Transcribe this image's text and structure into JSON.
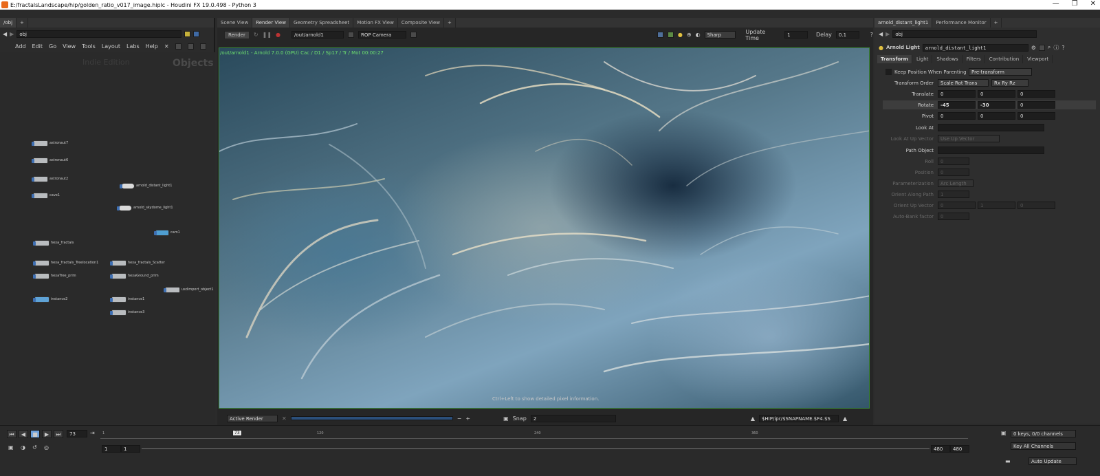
{
  "window": {
    "title": "E:/fractalsLandscape/hip/golden_ratio_v017_image.hiplc - Houdini FX 19.0.498 - Python 3",
    "controls": [
      "—",
      "❐",
      "✕"
    ]
  },
  "left": {
    "tab": "/obj",
    "path": "obj",
    "menu": [
      "Add",
      "Edit",
      "Go",
      "View",
      "Tools",
      "Layout",
      "Labs",
      "Help"
    ],
    "watermark": "Indie Edition",
    "context": "Objects",
    "nodes": [
      {
        "label": "astronaut7",
        "kind": "geo"
      },
      {
        "label": "astronaut6",
        "kind": "geo"
      },
      {
        "label": "astronaut2",
        "kind": "geo"
      },
      {
        "label": "cave1",
        "kind": "geo"
      },
      {
        "label": "arnold_distant_light1",
        "kind": "light"
      },
      {
        "label": "arnold_skydome_light1",
        "kind": "light"
      },
      {
        "label": "cam1",
        "kind": "cam"
      },
      {
        "label": "hexa_fractals",
        "kind": "geo"
      },
      {
        "label": "hexa_fractals_Treelocation1",
        "kind": "geo"
      },
      {
        "label": "hexa_fractals_Scatter",
        "kind": "geo"
      },
      {
        "label": "hexaTree_prim",
        "kind": "geo"
      },
      {
        "label": "hexaGround_prim",
        "kind": "geo"
      },
      {
        "label": "usdimport_object1",
        "kind": "geo"
      },
      {
        "label": "instance2",
        "kind": "geo"
      },
      {
        "label": "instance1",
        "kind": "geo"
      },
      {
        "label": "instance3",
        "kind": "geo"
      }
    ]
  },
  "viewer": {
    "tabs": [
      "Scene View",
      "Render View",
      "Geometry Spreadsheet",
      "Motion FX View",
      "Composite View"
    ],
    "active_tab": "Render View",
    "render_btn": "Render",
    "rop_path": "/out/arnold1",
    "camera": "ROP Camera",
    "quality": "Sharp",
    "update_time_label": "Update Time",
    "update_time": "1",
    "delay_label": "Delay",
    "delay": "0.1",
    "render_info": "/out/arnold1 - Arnold 7.0.0 (GPU) Cac / D1 / Sp17 / Tr / Mot 00:00:27",
    "hint": "Ctrl+Left to show detailed pixel information.",
    "bottom": {
      "active_render": "Active Render",
      "snap_label": "Snap",
      "snap_value": "2",
      "path": "$HIP/ipr/$SNAPNAME.$F4.$S"
    }
  },
  "params": {
    "tabs": [
      "arnold_distant_light1",
      "Performance Monitor"
    ],
    "path": "obj",
    "node_type": "Arnold Light",
    "node_name": "arnold_distant_light1",
    "subtabs": [
      "Transform",
      "Light",
      "Shadows",
      "Filters",
      "Contribution",
      "Viewport"
    ],
    "active_subtab": "Transform",
    "keep_pos_label": "Keep Position When Parenting",
    "keep_pos_value": "Pre-transform",
    "transform_order_label": "Transform Order",
    "transform_order": "Scale Rot Trans",
    "rot_order": "Rx Ry Rz",
    "translate_label": "Translate",
    "translate": [
      "0",
      "0",
      "0"
    ],
    "rotate_label": "Rotate",
    "rotate": [
      "-45",
      "-30",
      "0"
    ],
    "pivot_label": "Pivot",
    "pivot": [
      "0",
      "0",
      "0"
    ],
    "look_at_label": "Look At",
    "look_up_label": "Look At Up Vector",
    "look_up_value": "Use Up Vector",
    "path_object_label": "Path Object",
    "roll_label": "Roll",
    "roll": "0",
    "position_label": "Position",
    "position": "0",
    "param_label": "Parameterization",
    "param_value": "Arc Length",
    "orient_along_label": "Orient Along Path",
    "orient_along": "1",
    "orient_up_label": "Orient Up Vector",
    "orient_up": [
      "0",
      "1",
      "0"
    ],
    "autobank_label": "Auto-Bank factor",
    "autobank": "0"
  },
  "timeline": {
    "frame": "73",
    "ticks": [
      "1",
      "120",
      "240",
      "360"
    ],
    "start": "1",
    "start2": "1",
    "end": "480",
    "end2": "480",
    "keys": "0 keys, 0/0 channels",
    "key_all": "Key All Channels",
    "auto_update": "Auto Update",
    "current_frame_fraction": 0.152
  },
  "colors": {
    "accent_green": "#6ee06e",
    "stop_blue": "#6ea2dc",
    "houdini_orange": "#e96a1b"
  }
}
